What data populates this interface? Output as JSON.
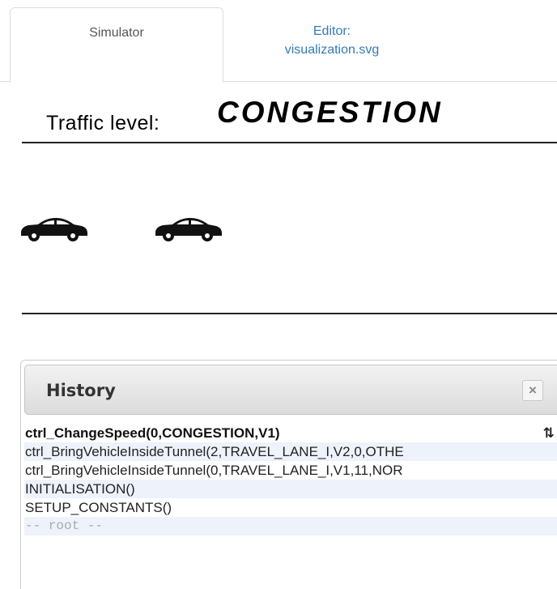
{
  "tabs": [
    {
      "label": "Simulator",
      "active": true
    },
    {
      "label_line1": "Editor:",
      "label_line2": "visualization.svg",
      "active": false
    }
  ],
  "visualization": {
    "traffic_label": "Traffic level:",
    "traffic_value": "CONGESTION",
    "cars": [
      {
        "icon": "car-icon"
      },
      {
        "icon": "car-icon"
      }
    ]
  },
  "history": {
    "title": "History",
    "close_glyph": "×",
    "sort_glyph": "⇅",
    "items": [
      "ctrl_ChangeSpeed(0,CONGESTION,V1)",
      "ctrl_BringVehicleInsideTunnel(2,TRAVEL_LANE_I,V2,0,OTHE",
      "ctrl_BringVehicleInsideTunnel(0,TRAVEL_LANE_I,V1,11,NOR",
      "INITIALISATION()",
      "SETUP_CONSTANTS()",
      "-- root --"
    ]
  },
  "colors": {
    "link": "#337ab7",
    "row_alt": "#eef2fb",
    "root_text": "#aaaaaa"
  }
}
